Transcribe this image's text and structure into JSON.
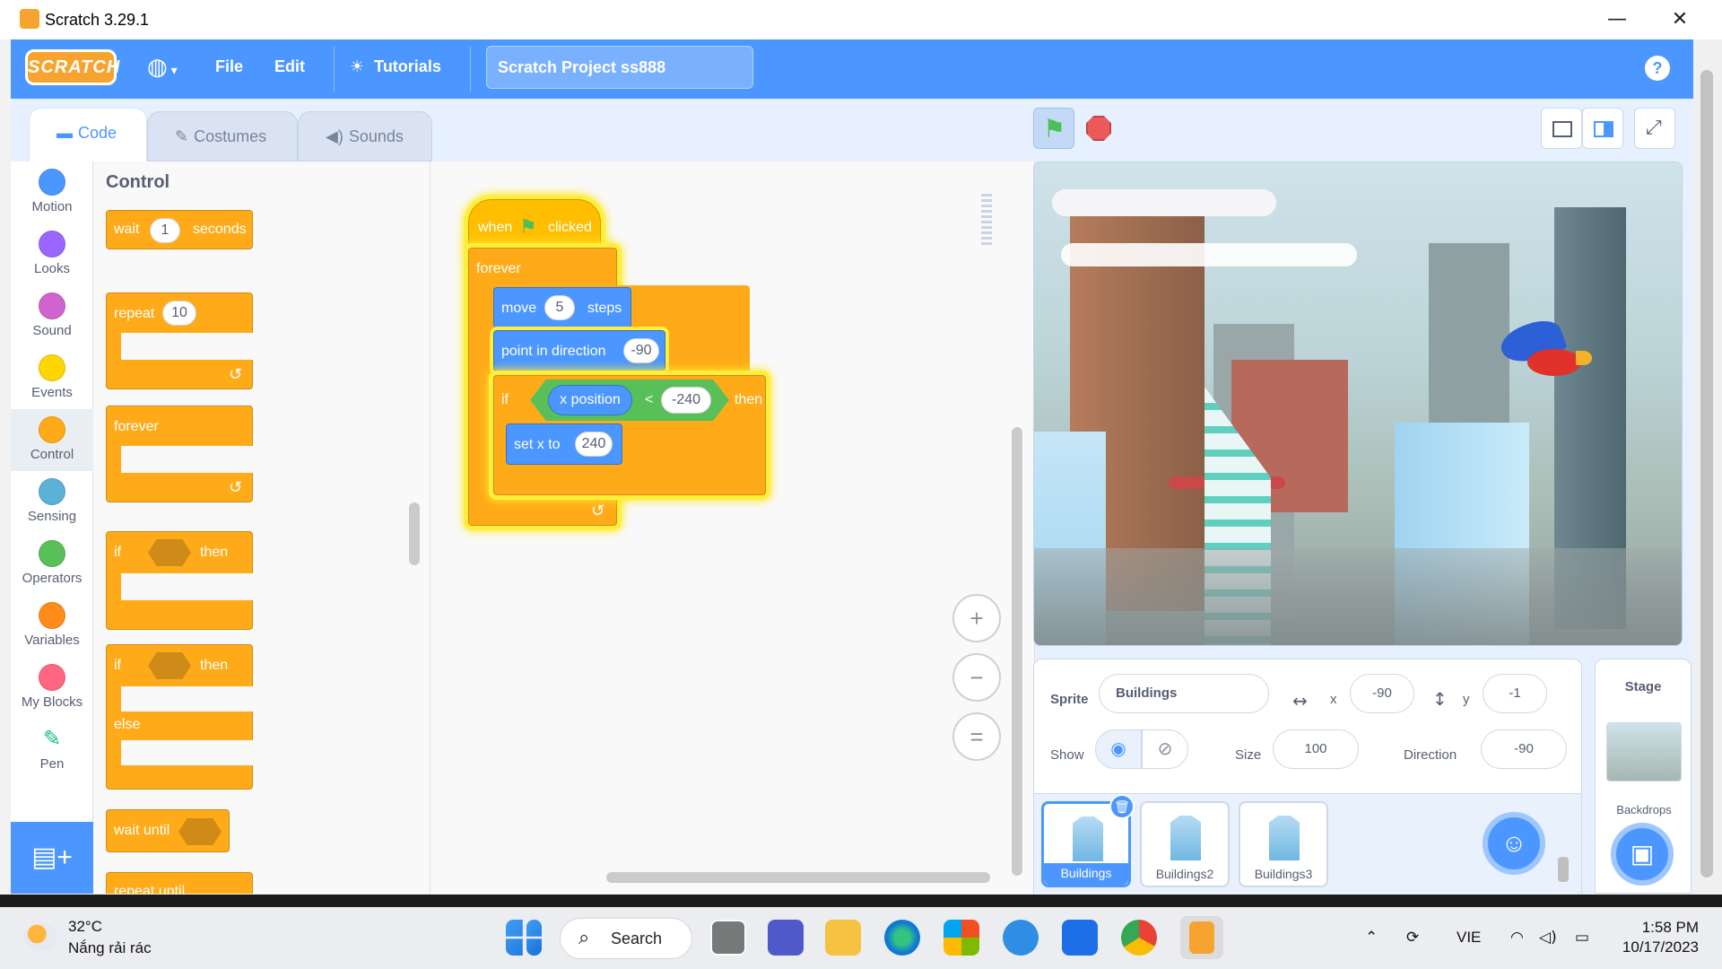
{
  "window": {
    "title": "Scratch 3.29.1",
    "minimize": "—",
    "maximize": "☐",
    "close": "✕"
  },
  "menu": {
    "file": "File",
    "edit": "Edit",
    "tutorials": "Tutorials",
    "project_title": "Scratch Project ss888",
    "logo": "SCRATCH",
    "help": "?"
  },
  "tabs": {
    "code": "Code",
    "costumes": "Costumes",
    "sounds": "Sounds"
  },
  "categories": [
    {
      "label": "Motion",
      "color": "#4c97ff"
    },
    {
      "label": "Looks",
      "color": "#9966ff"
    },
    {
      "label": "Sound",
      "color": "#cf63cf"
    },
    {
      "label": "Events",
      "color": "#ffd500"
    },
    {
      "label": "Control",
      "color": "#ffab19"
    },
    {
      "label": "Sensing",
      "color": "#5cb1d6"
    },
    {
      "label": "Operators",
      "color": "#59c059"
    },
    {
      "label": "Variables",
      "color": "#ff8c1a"
    },
    {
      "label": "My Blocks",
      "color": "#ff6680"
    },
    {
      "label": "Pen",
      "color": "#0fbd8c"
    }
  ],
  "palette": {
    "heading": "Control",
    "wait": {
      "pre": "wait",
      "value": "1",
      "post": "seconds"
    },
    "repeat": {
      "pre": "repeat",
      "value": "10"
    },
    "forever": "forever",
    "if_then": {
      "if": "if",
      "then": "then"
    },
    "if_else": {
      "if": "if",
      "then": "then",
      "else": "else"
    },
    "wait_until": "wait until",
    "repeat_until": "repeat until"
  },
  "script": {
    "hat": {
      "when": "when",
      "clicked": "clicked"
    },
    "forever": "forever",
    "move": {
      "pre": "move",
      "value": "5",
      "post": "steps"
    },
    "point": {
      "pre": "point in direction",
      "value": "-90"
    },
    "if": {
      "if": "if",
      "reporter": "x position",
      "op": "<",
      "value": "-240",
      "then": "then"
    },
    "setx": {
      "pre": "set x to",
      "value": "240"
    }
  },
  "zoom": {
    "in": "+",
    "out": "−",
    "reset": "="
  },
  "sprite_info": {
    "sprite_label": "Sprite",
    "sprite_name": "Buildings",
    "x_label": "x",
    "x": "-90",
    "y_label": "y",
    "y": "-1",
    "show_label": "Show",
    "size_label": "Size",
    "size": "100",
    "direction_label": "Direction",
    "direction": "-90"
  },
  "sprites": [
    "Buildings",
    "Buildings2",
    "Buildings3"
  ],
  "stage_pane": {
    "title": "Stage",
    "backdrops": "Backdrops"
  },
  "taskbar": {
    "weather_temp": "32°C",
    "weather_desc": "Nắng rải rác",
    "search": "Search",
    "lang": "VIE",
    "time": "1:58 PM",
    "date": "10/17/2023"
  }
}
